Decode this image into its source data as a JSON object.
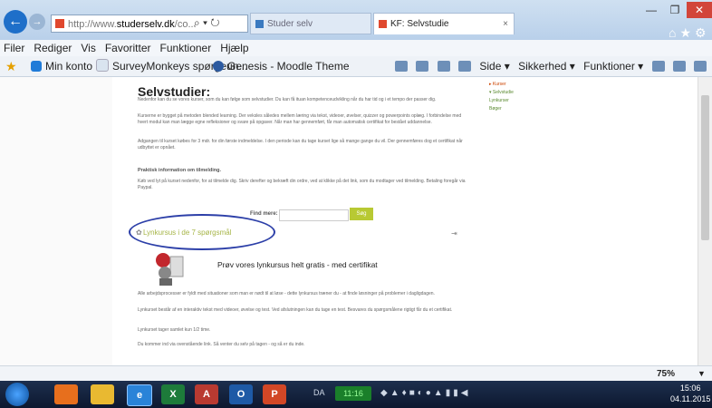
{
  "browser": {
    "url_protocol": "http://www.",
    "url_host": "studerselv.dk",
    "url_rest": "/co...",
    "tabs": [
      {
        "label": "Studer selv"
      },
      {
        "label": "KF: Selvstudie"
      }
    ],
    "tab_close": "×",
    "window": {
      "minimize": "—",
      "maximize": "❐",
      "close": "✕"
    },
    "right_icons": "⌂★⚙"
  },
  "menu": [
    "Filer",
    "Rediger",
    "Vis",
    "Favoritter",
    "Funktioner",
    "Hjælp"
  ],
  "favorites": {
    "items": [
      {
        "label": "Min konto"
      },
      {
        "label": "SurveyMonkeys spørgeun..."
      },
      {
        "label": "Genesis - Moodle Theme"
      }
    ],
    "commands": [
      "Side ▾",
      "Sikkerhed ▾",
      "Funktioner ▾"
    ]
  },
  "page": {
    "title": "Selvstudier:",
    "paragraphs": [
      "Nedenfor kan du se vores kurser, som du kan følge som selvstudier. Du kan få ituan kompetenceudvikling når du har tid og i et tempo der passer dig.",
      "Kurserne er bygget på metoden blended learning. Der veksles således mellem læring via tekst, videoer, øvelser, quizzer og powerpoints oplæg. I forbindelse med hvert modul kan man lægge egne refleksioner og svare på opgaver. Når man har gennemført, får man automatisk certifikat for bestået uddannelse.",
      "Adgangen til kurset købes for 3 mdr. for din første indmeldelse. I den periode kan du tage kurset lige så mange gange du vil. Der gennemføres dog et certifikat når udbyttet er opnået.",
      "Køb ved lyt på kurset nedenfor, for at tilmelde dig. Skriv derefter og bekræft din ordre, ved at klikke på det link, som du modtager ved tilmelding. Betaling foregår via Paypal.",
      "Alle arbejdsprocesser er fyldt med situationer som man er nødt til at løse - dette lynkursus træner du - at finde løsninger på problemer i dagligdagen.",
      "Lynkurset består af en interaktiv tekst med videoer, øvelse og test. Ved afslutningen kan du tage en test. Besvares du spørgsmålene rigtigt får du et certifikat.",
      "Lynkurset tager samlet kun 1/2 time.",
      "Du kommer ind via ovenstående link. Så venter du selv på tagen - og så er du inde."
    ],
    "bold_heading": "Praktisk information om tilmelding.",
    "find_label": "Find mere:",
    "find_button": "Søg",
    "sidebar": [
      "▸ Kurser",
      "▾ Selvstudie",
      "  Lynkurser",
      "  Bøger"
    ],
    "course_link": "Lynkursus i de 7 spørgsmål",
    "share_icon": "⇥",
    "promo_title": "Prøv vores lynkursus helt gratis - med certifikat"
  },
  "zoom": {
    "value": "75%",
    "arrow": "▼"
  },
  "taskbar": {
    "apps": [
      "",
      "",
      "e",
      "X",
      "A",
      "O",
      "P"
    ],
    "lang": "DA",
    "tray_time": "11:16",
    "tray_icons": "◆▲♦■◐●▲▮▮◀",
    "clock_time": "15:06",
    "clock_date": "04.11.2015"
  }
}
